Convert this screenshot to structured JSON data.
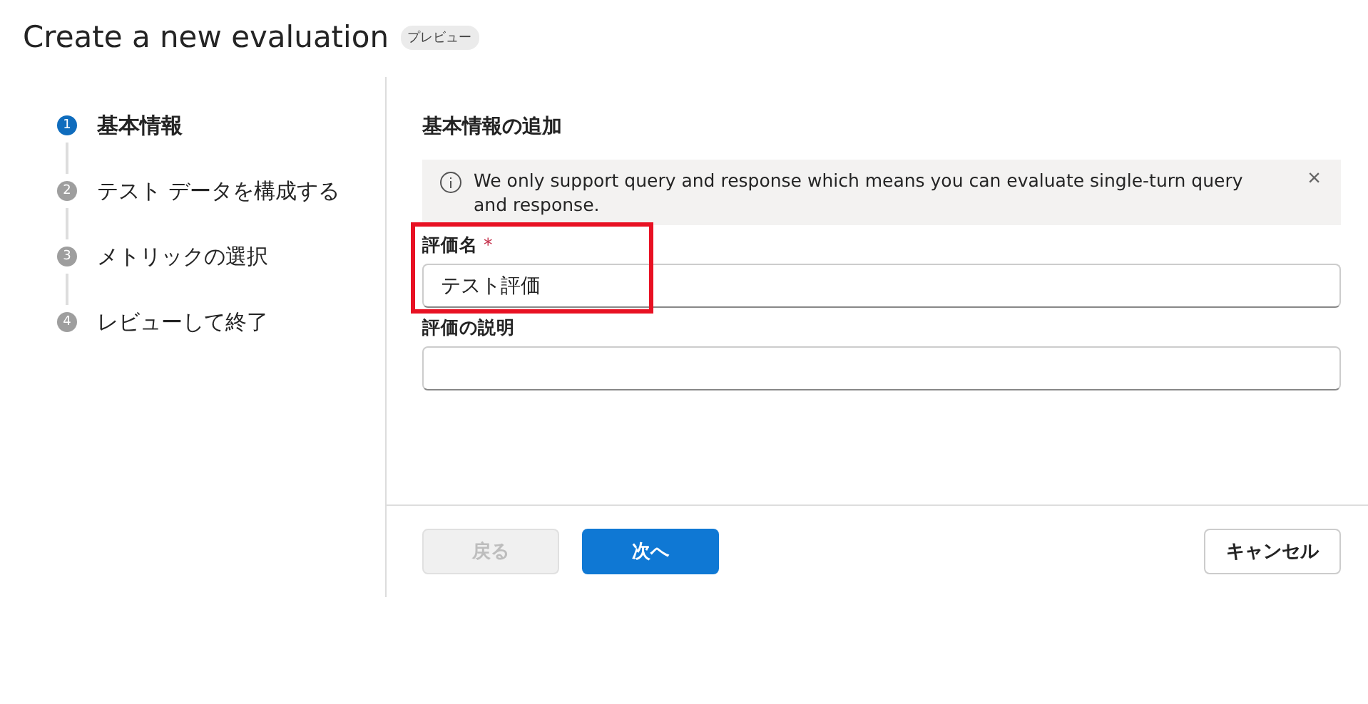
{
  "page_title": "Create a new evaluation",
  "badge": "プレビュー",
  "steps": [
    {
      "number": "1",
      "label": "基本情報",
      "selected": true
    },
    {
      "number": "2",
      "label": "テスト データを構成する",
      "selected": false
    },
    {
      "number": "3",
      "label": "メトリックの選択",
      "selected": false
    },
    {
      "number": "4",
      "label": "レビューして終了",
      "selected": false
    }
  ],
  "section_title": "基本情報の追加",
  "info_bar": {
    "message": "We only support query and response which means you can evaluate single-turn query and response.",
    "close": "×"
  },
  "fields": [
    {
      "label": "評価名",
      "required": true,
      "value": "テスト評価",
      "highlighted": true
    },
    {
      "label": "評価の説明",
      "required": false,
      "highlighted": false
    }
  ],
  "required_mark": "*",
  "buttons": [
    {
      "label": "戻る",
      "kind": "secondary",
      "disabled": true
    },
    {
      "label": "次へ",
      "kind": "primary",
      "disabled": false
    },
    {
      "label": "キャンセル",
      "kind": "cancel",
      "disabled": false
    }
  ]
}
